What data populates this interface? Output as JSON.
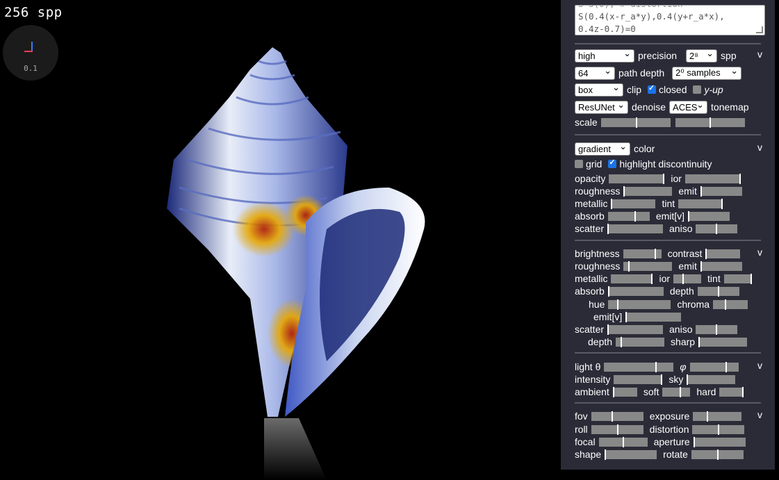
{
  "status": {
    "spp": "256 spp",
    "gizmo_scale": "0.1"
  },
  "expression": {
    "lines": [
      "S(0.4(x-r_a*y),0.4(y+r_a*x),",
      "0.4z-0.7)=0"
    ],
    "hidden_line": "S=S(0), # distortion"
  },
  "render": {
    "precision": {
      "value": "high",
      "label": "precision"
    },
    "spp": {
      "value": "2⁸",
      "label": "spp"
    },
    "path_depth": {
      "value": "64",
      "label": "path depth"
    },
    "samples": {
      "value": "2⁰ samples"
    },
    "clip": {
      "value": "box",
      "label": "clip"
    },
    "closed": {
      "label": "closed",
      "checked": true
    },
    "y_up": {
      "label": "y-up",
      "checked": false
    },
    "denoise": {
      "value": "ResUNet",
      "label": "denoise"
    },
    "tonemap": {
      "value": "ACES",
      "label": "tonemap"
    },
    "scale": {
      "label": "scale",
      "values": [
        0.52,
        0.5
      ]
    }
  },
  "material": {
    "color": {
      "value": "gradient",
      "label": "color"
    },
    "grid": {
      "label": "grid",
      "checked": false
    },
    "highlight": {
      "label": "highlight discontinuity",
      "checked": true
    },
    "sliders": [
      {
        "label": "opacity",
        "value": 1.0
      },
      {
        "label": "ior",
        "value": 1.0
      },
      {
        "label": "roughness",
        "value": 0.0
      },
      {
        "label": "emit",
        "value": 0.0
      },
      {
        "label": "metallic",
        "value": 0.0
      },
      {
        "label": "tint",
        "value": 1.0
      },
      {
        "label": "absorb",
        "value": 0.65
      },
      {
        "label": "emit[v]",
        "value": 0.0
      },
      {
        "label": "scatter",
        "value": 0.0
      },
      {
        "label": "aniso",
        "value": 0.5
      }
    ]
  },
  "adjust": {
    "sliders": [
      {
        "label": "brightness",
        "value": 0.85
      },
      {
        "label": "contrast",
        "value": 0.0
      },
      {
        "label": "roughness",
        "value": 0.1
      },
      {
        "label": "emit",
        "value": 0.0
      },
      {
        "label": "metallic",
        "value": 1.0
      },
      {
        "label": "ior",
        "value": 0.35
      },
      {
        "label": "tint",
        "value": 1.0
      },
      {
        "label": "absorb",
        "value": 0.0
      },
      {
        "label": "depth",
        "value": 0.5
      },
      {
        "label": "hue",
        "value": 0.15
      },
      {
        "label": "chroma",
        "value": 0.35
      },
      {
        "label": "emit[v]",
        "value": 0.0
      },
      {
        "label": "scatter",
        "value": 0.0
      },
      {
        "label": "aniso",
        "value": 0.5
      },
      {
        "label": "depth",
        "value": 0.1
      },
      {
        "label": "sharp",
        "value": 0.0
      }
    ]
  },
  "lighting": {
    "sliders": [
      {
        "label": "light θ",
        "value": 0.75
      },
      {
        "label": "φ",
        "value": 0.75
      },
      {
        "label": "intensity",
        "value": 1.0
      },
      {
        "label": "sky",
        "value": 0.0
      },
      {
        "label": "ambient",
        "value": 0.0
      },
      {
        "label": "soft",
        "value": 0.65
      },
      {
        "label": "hard",
        "value": 1.0
      }
    ]
  },
  "camera": {
    "sliders": [
      {
        "label": "fov",
        "value": 0.4
      },
      {
        "label": "exposure",
        "value": 0.3
      },
      {
        "label": "roll",
        "value": 0.5
      },
      {
        "label": "distortion",
        "value": 0.5
      },
      {
        "label": "focal",
        "value": 0.5
      },
      {
        "label": "aperture",
        "value": 0.0
      },
      {
        "label": "shape",
        "value": 0.0
      },
      {
        "label": "rotate",
        "value": 0.5
      }
    ]
  },
  "collapse_label": "v",
  "colors": {
    "panel": "#2b2b38",
    "slider": "#888888",
    "accent": "#1a73e8"
  }
}
